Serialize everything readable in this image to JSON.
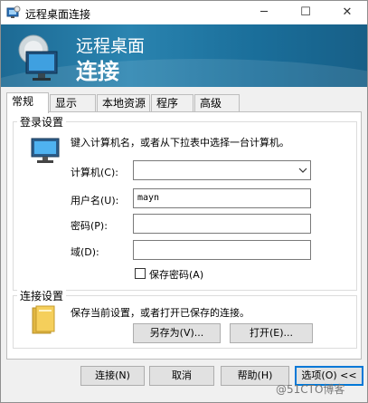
{
  "window": {
    "title": "远程桌面连接"
  },
  "title_buttons": {
    "minimize": "─",
    "maximize": "☐",
    "close": "✕"
  },
  "banner": {
    "line1": "远程桌面",
    "line2": "连接"
  },
  "tabs": [
    {
      "label": "常规"
    },
    {
      "label": "显示"
    },
    {
      "label": "本地资源"
    },
    {
      "label": "程序"
    },
    {
      "label": "高级"
    }
  ],
  "login_group": {
    "title": "登录设置",
    "description": "键入计算机名，或者从下拉表中选择一台计算机。",
    "computer_label": "计算机(C):",
    "computer_value": "",
    "username_label": "用户名(U):",
    "username_value": "mayn",
    "password_label": "密码(P):",
    "password_value": "",
    "domain_label": "域(D):",
    "domain_value": "",
    "save_password_label": "保存密码(A)",
    "save_password_checked": false
  },
  "connection_group": {
    "title": "连接设置",
    "description": "保存当前设置，或者打开已保存的连接。",
    "save_as_label": "另存为(V)...",
    "open_label": "打开(E)..."
  },
  "footer": {
    "connect_label": "连接(N)",
    "cancel_label": "取消",
    "help_label": "帮助(H)",
    "options_label": "选项(O) <<"
  },
  "watermark": "@51CTO博客",
  "colors": {
    "banner": "#2a84b0",
    "focus": "#0078d7"
  }
}
